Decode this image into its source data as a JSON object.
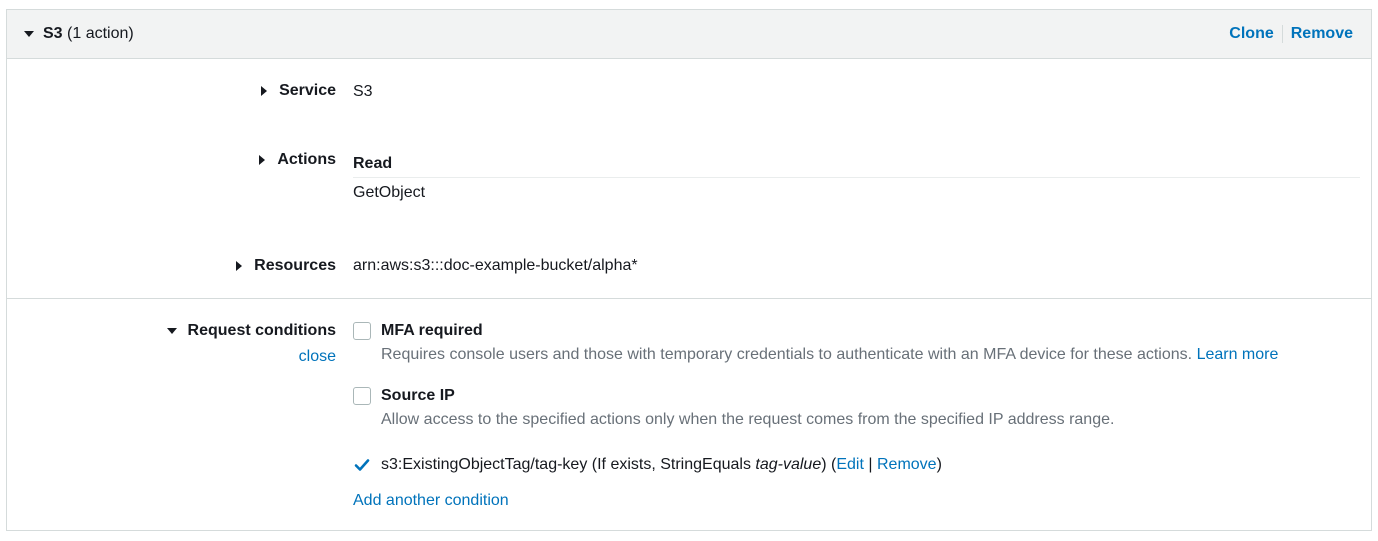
{
  "header": {
    "service": "S3",
    "count": "(1 action)",
    "clone_label": "Clone",
    "remove_label": "Remove"
  },
  "service": {
    "label": "Service",
    "value": "S3"
  },
  "actions": {
    "label": "Actions",
    "group": "Read",
    "items": [
      "GetObject"
    ]
  },
  "resources": {
    "label": "Resources",
    "value": "arn:aws:s3:::doc-example-bucket/alpha*"
  },
  "request_conditions": {
    "label": "Request conditions",
    "close_label": "close",
    "mfa": {
      "title": "MFA required",
      "checked": false,
      "description": "Requires console users and those with temporary credentials to authenticate with an MFA device for these actions.",
      "learn_more": "Learn more"
    },
    "source_ip": {
      "title": "Source IP",
      "checked": false,
      "description": "Allow access to the specified actions only when the request comes from the specified IP address range."
    },
    "tag_condition": {
      "checked": true,
      "key": "s3:ExistingObjectTag/tag-key",
      "operator": "(If exists, StringEquals",
      "value": "tag-value",
      "close_paren": ")",
      "open_paren": "(",
      "edit_label": "Edit",
      "separator": "|",
      "remove_label": "Remove",
      "end_paren": ")"
    },
    "add_another": "Add another condition"
  },
  "colors": {
    "link": "#0073bb",
    "header_bg": "#f2f3f3",
    "border": "#d5dbdb",
    "muted_text": "#687078"
  },
  "icons": [
    "caret-down-icon",
    "caret-right-icon",
    "checkmark-icon"
  ]
}
